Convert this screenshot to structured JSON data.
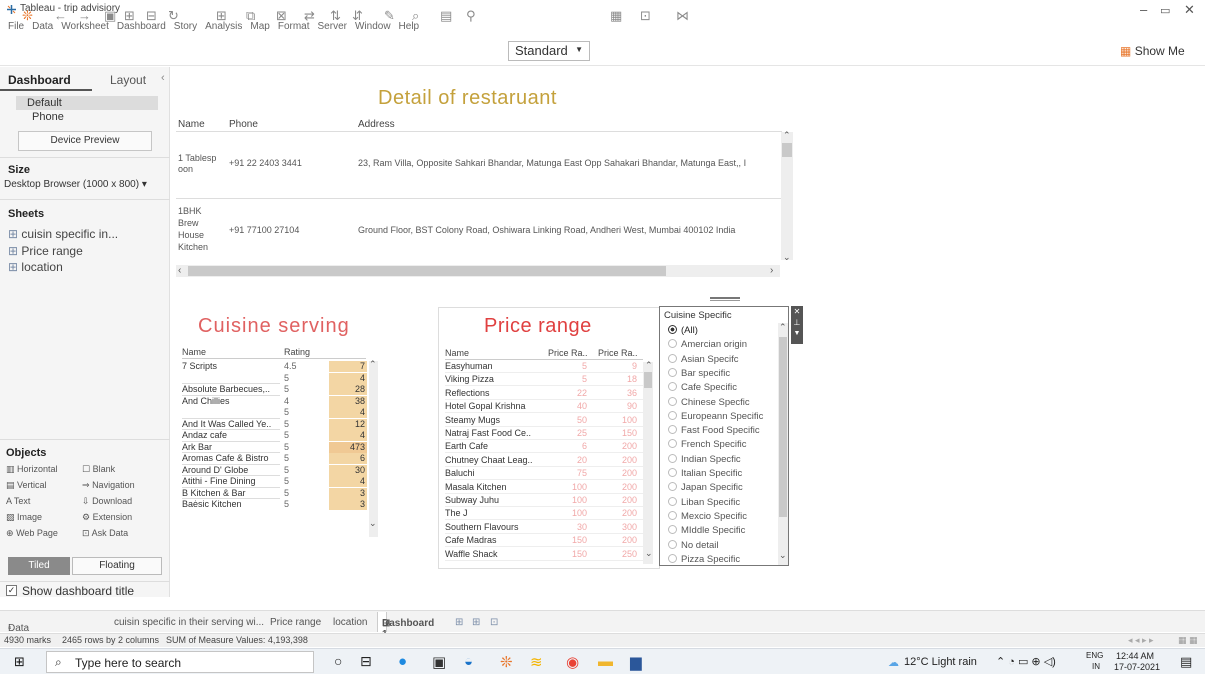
{
  "window": {
    "title": "Tableau - trip advisiory"
  },
  "menu": [
    "File",
    "Data",
    "Worksheet",
    "Dashboard",
    "Story",
    "Analysis",
    "Map",
    "Format",
    "Server",
    "Window",
    "Help"
  ],
  "toolbar": {
    "fit_select": "Standard",
    "show_me": "Show Me"
  },
  "left_pane": {
    "tab_dashboard": "Dashboard",
    "tab_layout": "Layout",
    "devices": [
      "Default",
      "Phone"
    ],
    "device_preview": "Device Preview",
    "size_label": "Size",
    "size_value": "Desktop Browser (1000 x 800) ▾",
    "sheets_label": "Sheets",
    "sheets": [
      "cuisin specific in...",
      "Price range",
      "location"
    ],
    "objects_label": "Objects",
    "objects": [
      [
        "Horizontal",
        "Blank"
      ],
      [
        "Vertical",
        "Navigation"
      ],
      [
        "Text",
        "Download"
      ],
      [
        "Image",
        "Extension"
      ],
      [
        "Web Page",
        "Ask Data"
      ]
    ],
    "tiled": "Tiled",
    "floating": "Floating",
    "show_title": "Show dashboard title"
  },
  "detail": {
    "title": "Detail of restaruant",
    "headers": {
      "name": "Name",
      "phone": "Phone",
      "address": "Address"
    },
    "rows": [
      {
        "name": "1 Tablesp\noon",
        "phone": "+91 22 2403 3441",
        "address": "23, Ram Villa, Opposite Sahkari Bhandar, Matunga East Opp Sahakari Bhandar, Matunga East,, I"
      },
      {
        "name": "1BHK\nBrew\nHouse\nKitchen",
        "phone": "+91 77100 27104",
        "address": "Ground Floor, BST Colony Road, Oshiwara Linking Road, Andheri West, Mumbai 400102 India"
      }
    ]
  },
  "cuisine": {
    "title": "Cuisine serving",
    "headers": {
      "name": "Name",
      "rating": "Rating"
    },
    "rows": [
      {
        "name": "7 Scripts",
        "rating": "4.5",
        "value": "7"
      },
      {
        "name": "",
        "rating": "5",
        "value": "4"
      },
      {
        "name": "Absolute Barbecues,..",
        "rating": "5",
        "value": "28"
      },
      {
        "name": "And Chillies",
        "rating": "4",
        "value": "38"
      },
      {
        "name": "",
        "rating": "5",
        "value": "4"
      },
      {
        "name": "And It Was Called Ye..",
        "rating": "5",
        "value": "12"
      },
      {
        "name": "Andaz cafe",
        "rating": "5",
        "value": "4"
      },
      {
        "name": "Ark Bar",
        "rating": "5",
        "value": "473"
      },
      {
        "name": "Aromas Cafe & Bistro",
        "rating": "5",
        "value": "6"
      },
      {
        "name": "Around D' Globe",
        "rating": "5",
        "value": "30"
      },
      {
        "name": "Atithi - Fine Dining",
        "rating": "5",
        "value": "4"
      },
      {
        "name": "B Kitchen & Bar",
        "rating": "5",
        "value": "3"
      },
      {
        "name": "Baėsic Kitchen",
        "rating": "5",
        "value": "3"
      }
    ]
  },
  "price": {
    "title": "Price range",
    "headers": {
      "name": "Name",
      "min": "Price Ra..",
      "max": "Price Ra.."
    },
    "rows": [
      {
        "name": "Easyhuman",
        "min": "5",
        "max": "9"
      },
      {
        "name": "Viking Pizza",
        "min": "5",
        "max": "18"
      },
      {
        "name": "Reflections",
        "min": "22",
        "max": "36"
      },
      {
        "name": "Hotel Gopal Krishna",
        "min": "40",
        "max": "90"
      },
      {
        "name": "Steamy Mugs",
        "min": "50",
        "max": "100"
      },
      {
        "name": "Natraj Fast Food Ce..",
        "min": "25",
        "max": "150"
      },
      {
        "name": "Earth Cafe",
        "min": "6",
        "max": "200"
      },
      {
        "name": "Chutney Chaat Leag..",
        "min": "20",
        "max": "200"
      },
      {
        "name": "Baluchi",
        "min": "75",
        "max": "200"
      },
      {
        "name": "Masala Kitchen",
        "min": "100",
        "max": "200"
      },
      {
        "name": "Subway Juhu",
        "min": "100",
        "max": "200"
      },
      {
        "name": "The J",
        "min": "100",
        "max": "200"
      },
      {
        "name": "Southern Flavours",
        "min": "30",
        "max": "300"
      },
      {
        "name": "Cafe Madras",
        "min": "150",
        "max": "200"
      },
      {
        "name": "Waffle Shack",
        "min": "150",
        "max": "250"
      }
    ]
  },
  "filter": {
    "title": "Cuisine Specific",
    "options": [
      "(All)",
      "Amercian origin",
      "Asian Specifc",
      "Bar specific",
      "Cafe Specific",
      "Chinese Specfic",
      "Europeann Specific",
      "Fast Food Specific",
      "French Specific",
      "Indian Specfic",
      "Italian Specific",
      "Japan Specific",
      "Liban Specific",
      "Mexcio Specific",
      "MIddle Specific",
      "No detail",
      "Pizza Specific"
    ],
    "selected": "(All)"
  },
  "tabs": [
    "Data Source",
    "cuisin specific in their serving wi...",
    "Price range",
    "location",
    "Dashboard 1"
  ],
  "status": {
    "marks": "4930 marks",
    "rows": "2465 rows by 2 columns",
    "sum": "SUM of Measure Values: 4,193,398"
  },
  "taskbar": {
    "search_placeholder": "Type here to search",
    "weather": "12°C  Light rain",
    "lang": "ENG",
    "region": "IN",
    "time": "12:44 AM",
    "date": "17-07-2021"
  },
  "colors": {
    "detail_title": "#c4a13c",
    "cuisine_title": "#e06161",
    "price_title": "#e04040",
    "highlight": "#f3d6a4",
    "price_text": "#f1a8a8"
  }
}
